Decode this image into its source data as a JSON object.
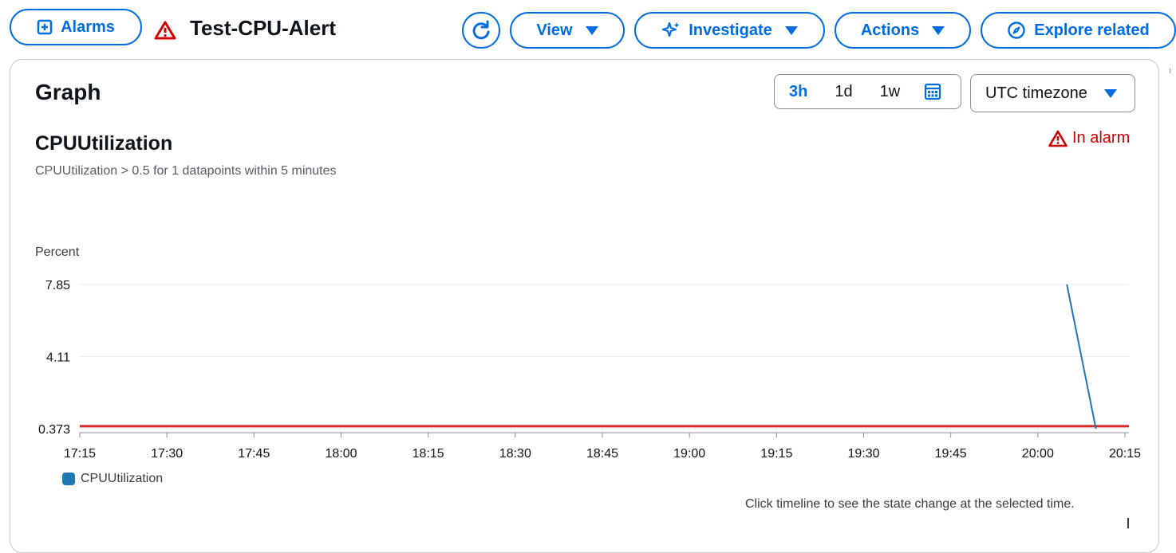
{
  "header": {
    "alarms_label": "Alarms",
    "alarm_name": "Test-CPU-Alert",
    "view_label": "View",
    "investigate_label": "Investigate",
    "actions_label": "Actions",
    "explore_label": "Explore related"
  },
  "graph": {
    "heading": "Graph",
    "ranges": [
      "3h",
      "1d",
      "1w"
    ],
    "active_range": "3h",
    "timezone": "UTC timezone",
    "metric": "CPUUtilization",
    "condition": "CPUUtilization > 0.5 for 1 datapoints within 5 minutes",
    "state": "In alarm",
    "unit": "Percent",
    "footer_note": "Click timeline to see the state change at the selected time."
  },
  "colors": {
    "accent": "#006ce0",
    "alarm_red": "#d10000",
    "series_blue": "#1f77b4",
    "threshold_red": "#d62728"
  },
  "chart_data": {
    "type": "line",
    "ylabel": "Percent",
    "yticks": [
      "7.85",
      "4.11",
      "0.373"
    ],
    "ylim": [
      0.373,
      7.85
    ],
    "xticks": [
      "17:15",
      "17:30",
      "17:45",
      "18:00",
      "18:15",
      "18:30",
      "18:45",
      "19:00",
      "19:15",
      "19:30",
      "19:45",
      "20:00",
      "20:15"
    ],
    "xlim": [
      "17:15",
      "20:15"
    ],
    "threshold": 0.5,
    "series": [
      {
        "name": "CPUUtilization",
        "points": [
          {
            "x": "20:05",
            "y": 7.85
          },
          {
            "x": "20:10",
            "y": 0.373
          }
        ]
      }
    ],
    "grid": true,
    "legend": "bottom-left"
  }
}
